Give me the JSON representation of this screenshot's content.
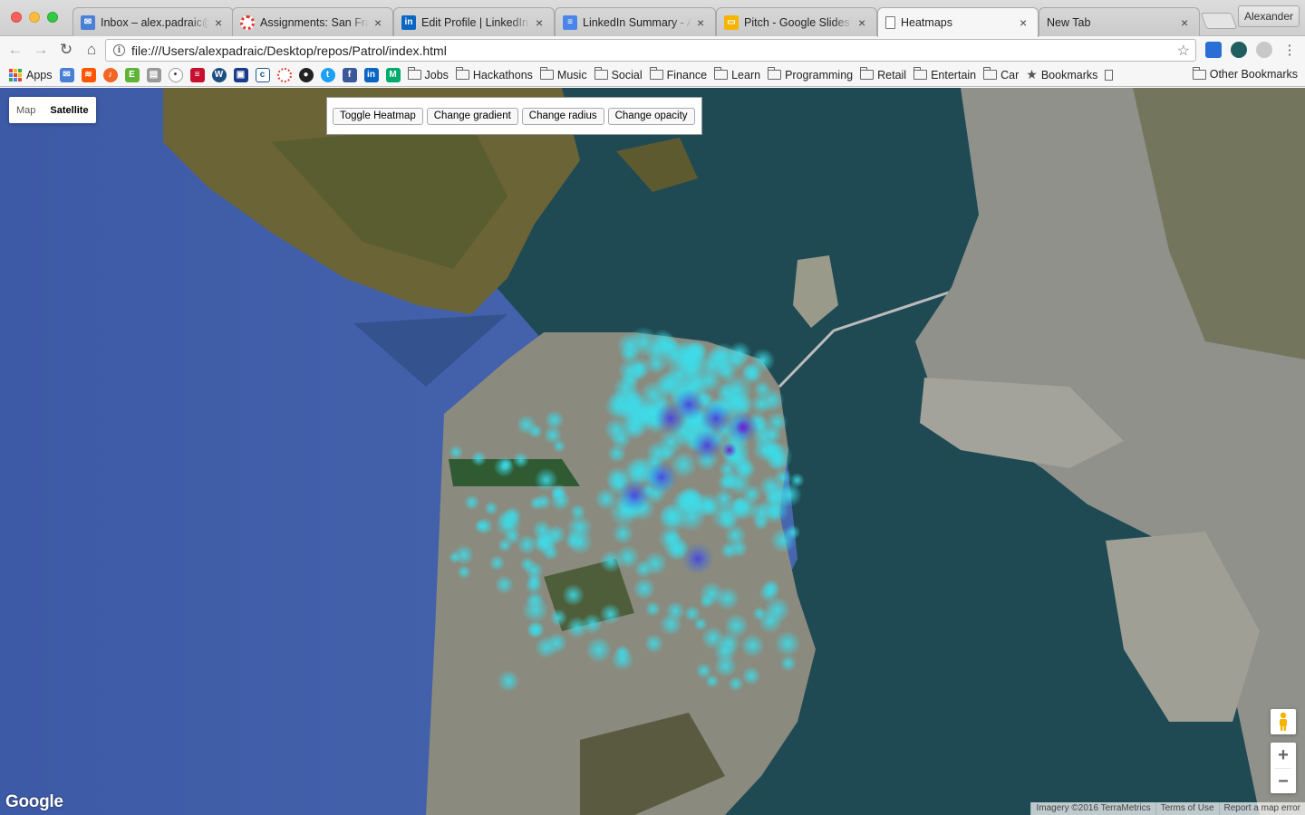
{
  "browser": {
    "tabs": [
      {
        "title": "Inbox – alex.padraic@gmail.com",
        "icon": "inbox-icon"
      },
      {
        "title": "Assignments: San Francisco",
        "icon": "lifebuoy-icon"
      },
      {
        "title": "Edit Profile | LinkedIn",
        "icon": "linkedin-icon"
      },
      {
        "title": "LinkedIn Summary - Ab",
        "icon": "docs-icon"
      },
      {
        "title": "Pitch - Google Slides",
        "icon": "slides-icon"
      },
      {
        "title": "Heatmaps",
        "icon": "page-icon",
        "active": true
      },
      {
        "title": "New Tab",
        "icon": ""
      }
    ],
    "profile": "Alexander",
    "url": "file:///Users/alexpadraic/Desktop/repos/Patrol/index.html"
  },
  "bookmarks": {
    "apps_label": "Apps",
    "folders": [
      "Jobs",
      "Hackathons",
      "Music",
      "Social",
      "Finance",
      "Learn",
      "Programming",
      "Retail",
      "Entertain",
      "Car"
    ],
    "bookmarks_label": "Bookmarks",
    "other_label": "Other Bookmarks"
  },
  "map": {
    "type_map": "Map",
    "type_satellite": "Satellite",
    "selected_type": "Satellite",
    "buttons": {
      "toggle": "Toggle Heatmap",
      "gradient": "Change gradient",
      "radius": "Change radius",
      "opacity": "Change opacity"
    },
    "zoom_in": "+",
    "zoom_out": "−",
    "logo": "Google",
    "attribution": "Imagery ©2016 TerraMetrics",
    "terms": "Terms of Use",
    "report": "Report a map error"
  },
  "colors": {
    "ocean": "#3f5ea8",
    "bay": "#1f4a53",
    "heat_low": "#39d7e3",
    "heat_mid": "#3a5bd8",
    "heat_high": "#6a25c7"
  }
}
